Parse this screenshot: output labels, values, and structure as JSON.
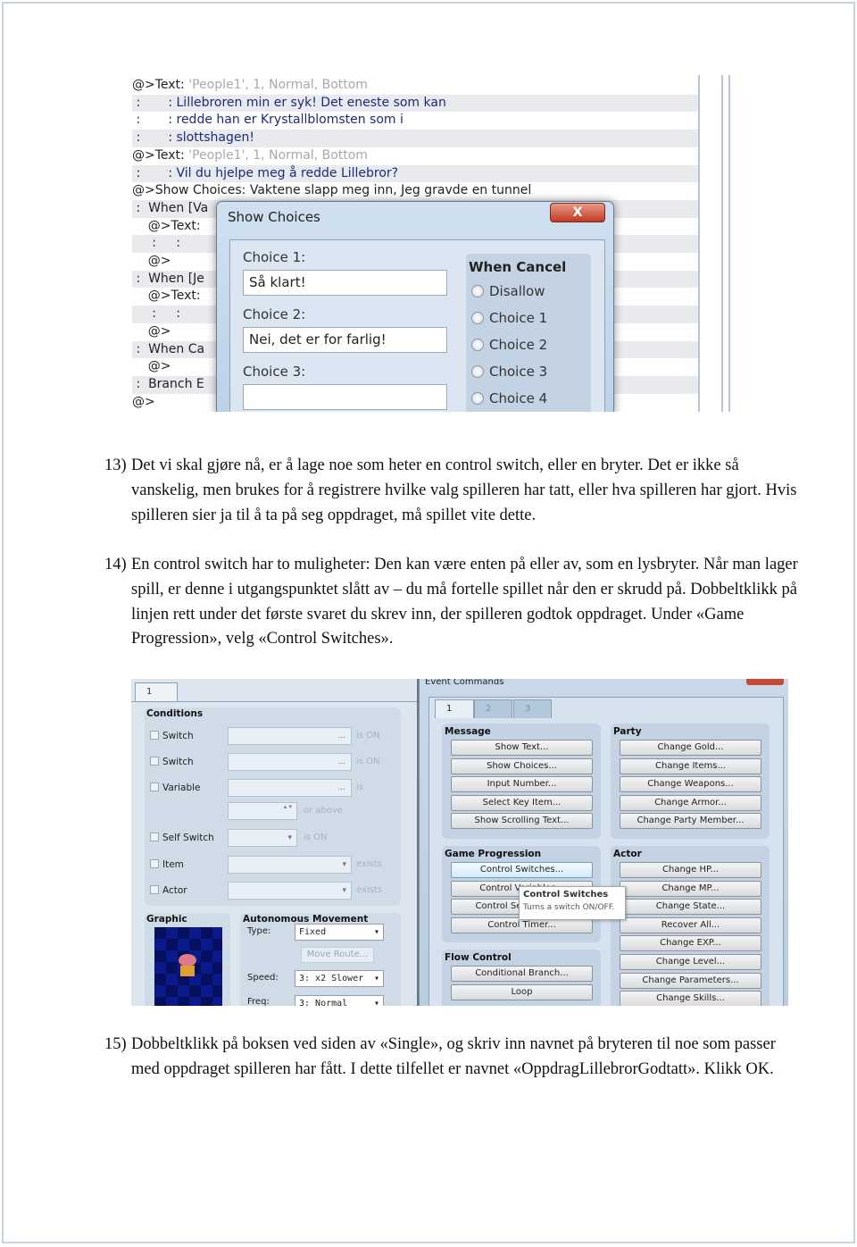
{
  "screenshot1": {
    "list_rows": [
      {
        "prefix": "@>Text: ",
        "gray": "'People1', 1, Normal, Bottom",
        "blue": ""
      },
      {
        "prefix": " :       : ",
        "gray": "",
        "blue": "Lillebroren min er syk! Det eneste som kan"
      },
      {
        "prefix": " :       : ",
        "gray": "",
        "blue": "redde han er Krystallblomsten som i"
      },
      {
        "prefix": " :       : ",
        "gray": "",
        "blue": "slottshagen!"
      },
      {
        "prefix": "@>Text: ",
        "gray": "'People1', 1, Normal, Bottom",
        "blue": ""
      },
      {
        "prefix": " :       : ",
        "gray": "",
        "blue": "Vil du hjelpe meg å redde Lillebror?"
      },
      {
        "prefix": "@>Show Choices: Vaktene slapp meg inn, Jeg gravde en tunnel",
        "gray": "",
        "blue": ""
      },
      {
        "prefix": " :  When [Va",
        "gray": "",
        "blue": ""
      },
      {
        "prefix": "    @>Text:",
        "gray": "",
        "blue": ""
      },
      {
        "prefix": "     :     :",
        "gray": "",
        "blue": ""
      },
      {
        "prefix": "    @>",
        "gray": "",
        "blue": ""
      },
      {
        "prefix": " :  When [Je",
        "gray": "",
        "blue": ""
      },
      {
        "prefix": "    @>Text:",
        "gray": "",
        "blue": ""
      },
      {
        "prefix": "     :     :",
        "gray": "",
        "blue": ""
      },
      {
        "prefix": "    @>",
        "gray": "",
        "blue": ""
      },
      {
        "prefix": " :  When Ca",
        "gray": "",
        "blue": ""
      },
      {
        "prefix": "    @>",
        "gray": "",
        "blue": ""
      },
      {
        "prefix": " :  Branch E",
        "gray": "",
        "blue": ""
      },
      {
        "prefix": "@>",
        "gray": "",
        "blue": ""
      }
    ],
    "dialog": {
      "title": "Show Choices",
      "close": "X",
      "choice1_label": "Choice 1:",
      "choice1_value": "Så klart!",
      "choice2_label": "Choice 2:",
      "choice2_value": "Nei, det er for farlig!",
      "choice3_label": "Choice 3:",
      "choice3_value": "",
      "when_cancel_title": "When Cancel",
      "when_cancel_options": [
        "Disallow",
        "Choice 1",
        "Choice 2",
        "Choice 3",
        "Choice 4"
      ]
    }
  },
  "paragraphs": [
    {
      "num": "13)",
      "text": "Det vi skal gjøre nå, er å lage noe som heter en control switch, eller en bryter. Det er ikke så vanskelig, men brukes for å registrere hvilke valg spilleren har tatt, eller hva spilleren har gjort. Hvis spilleren sier ja til å ta på seg oppdraget, må spillet vite dette."
    },
    {
      "num": "14)",
      "text": " En control switch har to muligheter: Den kan være enten på eller av, som en lysbryter. Når man lager spill, er denne i utgangspunktet slått av – du må fortelle spillet når den er skrudd på. Dobbeltklikk på linjen rett under det første svaret du skrev inn, der spilleren godtok oppdraget.  Under «Game Progression», velg «Control Switches»."
    },
    {
      "num": "15)",
      "text": "Dobbeltklikk på boksen ved siden av «Single», og skriv inn navnet på bryteren til noe som passer med oppdraget spilleren har fått. I dette tilfellet er navnet «OppdragLillebrorGodtatt». Klikk OK."
    }
  ],
  "screenshot2": {
    "page_tab": "1",
    "conditions": {
      "title": "Conditions",
      "rows": [
        {
          "label": "Switch",
          "field": "...",
          "suffix": "is ON"
        },
        {
          "label": "Switch",
          "field": "...",
          "suffix": "is ON"
        },
        {
          "label": "Variable",
          "field": "...",
          "suffix": "is"
        },
        {
          "label": "",
          "field": "",
          "suffix": "or above"
        },
        {
          "label": "Self Switch",
          "field": "",
          "suffix": "is ON"
        },
        {
          "label": "Item",
          "field": "",
          "suffix": "exists"
        },
        {
          "label": "Actor",
          "field": "",
          "suffix": "exists"
        }
      ]
    },
    "graphic_title": "Graphic",
    "movement": {
      "title": "Autonomous Movement",
      "type_label": "Type:",
      "type_value": "Fixed",
      "move_route": "Move Route...",
      "speed_label": "Speed:",
      "speed_value": "3: x2 Slower",
      "freq_label": "Freq:",
      "freq_value": "3: Normal"
    },
    "event_commands": {
      "title": "Event Commands",
      "tabs": [
        "1",
        "2",
        "3"
      ],
      "groups": {
        "message": {
          "title": "Message",
          "buttons": [
            "Show Text...",
            "Show Choices...",
            "Input Number...",
            "Select Key Item...",
            "Show Scrolling Text..."
          ]
        },
        "party": {
          "title": "Party",
          "buttons": [
            "Change Gold...",
            "Change Items...",
            "Change Weapons...",
            "Change Armor...",
            "Change Party Member..."
          ]
        },
        "game_progression": {
          "title": "Game Progression",
          "buttons": [
            "Control Switches...",
            "Control Variables...",
            "Control Self Switch...",
            "Control Timer..."
          ]
        },
        "actor": {
          "title": "Actor",
          "buttons": [
            "Change HP...",
            "Change MP...",
            "Change State...",
            "Recover All...",
            "Change EXP...",
            "Change Level...",
            "Change Parameters...",
            "Change Skills..."
          ]
        },
        "flow_control": {
          "title": "Flow Control",
          "buttons": [
            "Conditional Branch...",
            "Loop"
          ]
        }
      },
      "tooltip": {
        "title": "Control Switches",
        "text": "Turns a switch ON/OFF."
      }
    }
  }
}
